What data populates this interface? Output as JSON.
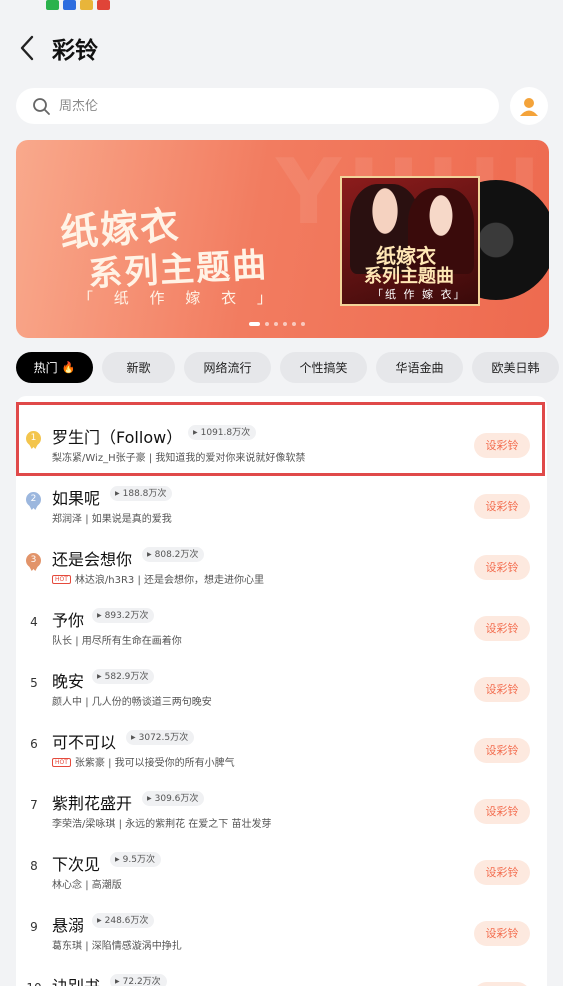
{
  "header": {
    "title": "彩铃"
  },
  "search": {
    "placeholder": "周杰伦"
  },
  "banner": {
    "title_line1": "纸嫁衣",
    "title_line2": "系列主题曲",
    "subtitle": "「 纸 作 嫁 衣 」",
    "album_line1": "纸嫁衣",
    "album_line2": "系列主题曲",
    "album_line3": "「纸 作 嫁 衣」",
    "background_text": "YUHUA"
  },
  "categories": [
    "热门",
    "新歌",
    "网络流行",
    "个性搞笑",
    "华语金曲",
    "欧美日韩"
  ],
  "songs": [
    {
      "rank": "1",
      "title": "罗生门（Follow）",
      "plays": "1091.8万次",
      "artist": "梨冻紧/Wiz_H张子豪",
      "lyric": "我知道我的爱对你来说就好像软禁",
      "hot": false
    },
    {
      "rank": "2",
      "title": "如果呢",
      "plays": "188.8万次",
      "artist": "郑润泽",
      "lyric": "如果说是真的爱我",
      "hot": false
    },
    {
      "rank": "3",
      "title": "还是会想你",
      "plays": "808.2万次",
      "artist": "林达浪/h3R3",
      "lyric": "还是会想你，想走进你心里",
      "hot": true
    },
    {
      "rank": "4",
      "title": "予你",
      "plays": "893.2万次",
      "artist": "队长",
      "lyric": "用尽所有生命在画着你",
      "hot": false
    },
    {
      "rank": "5",
      "title": "晚安",
      "plays": "582.9万次",
      "artist": "颜人中",
      "lyric": "几人份的畅谈道三两句晚安",
      "hot": false
    },
    {
      "rank": "6",
      "title": "可不可以",
      "plays": "3072.5万次",
      "artist": "张紫豪",
      "lyric": "我可以接受你的所有小脾气",
      "hot": true
    },
    {
      "rank": "7",
      "title": "紫荆花盛开",
      "plays": "309.6万次",
      "artist": "李荣浩/梁咏琪",
      "lyric": "永远的紫荆花 在爱之下 苗壮发芽",
      "hot": false
    },
    {
      "rank": "8",
      "title": "下次见",
      "plays": "9.5万次",
      "artist": "林心念",
      "lyric": "高潮版",
      "hot": false
    },
    {
      "rank": "9",
      "title": "悬溺",
      "plays": "248.6万次",
      "artist": "葛东琪",
      "lyric": "深陷情感漩涡中挣扎",
      "hot": false
    },
    {
      "rank": "10",
      "title": "诀别书",
      "plays": "72.2万次",
      "artist": "",
      "lyric": "",
      "hot": false
    }
  ],
  "set_button_label": "设彩铃",
  "hot_tag_label": "HOT",
  "separator": "|",
  "colors": {
    "accent": "#f36d4f",
    "highlight_border": "#e04949",
    "chip_active": "#000000"
  }
}
